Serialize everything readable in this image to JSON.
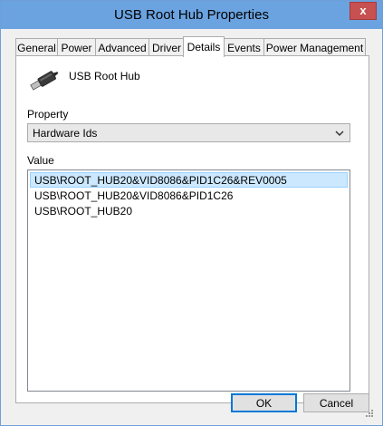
{
  "window": {
    "title": "USB Root Hub Properties",
    "close_label": "x"
  },
  "tabs": [
    {
      "label": "General"
    },
    {
      "label": "Power"
    },
    {
      "label": "Advanced"
    },
    {
      "label": "Driver"
    },
    {
      "label": "Details",
      "active": true
    },
    {
      "label": "Events"
    },
    {
      "label": "Power Management"
    }
  ],
  "details": {
    "device_name": "USB Root Hub",
    "property_label": "Property",
    "property_selected": "Hardware Ids",
    "value_label": "Value",
    "values": [
      "USB\\ROOT_HUB20&VID8086&PID1C26&REV0005",
      "USB\\ROOT_HUB20&VID8086&PID1C26",
      "USB\\ROOT_HUB20"
    ],
    "selected_index": 0
  },
  "buttons": {
    "ok_label": "OK",
    "cancel_label": "Cancel"
  },
  "colors": {
    "titlebar": "#6aa3e0",
    "close": "#c75050",
    "selection": "#cce8ff",
    "focus": "#0078d7"
  },
  "icons": [
    "usb-plug-icon",
    "close-icon",
    "chevron-down-icon",
    "resize-grip-icon"
  ]
}
